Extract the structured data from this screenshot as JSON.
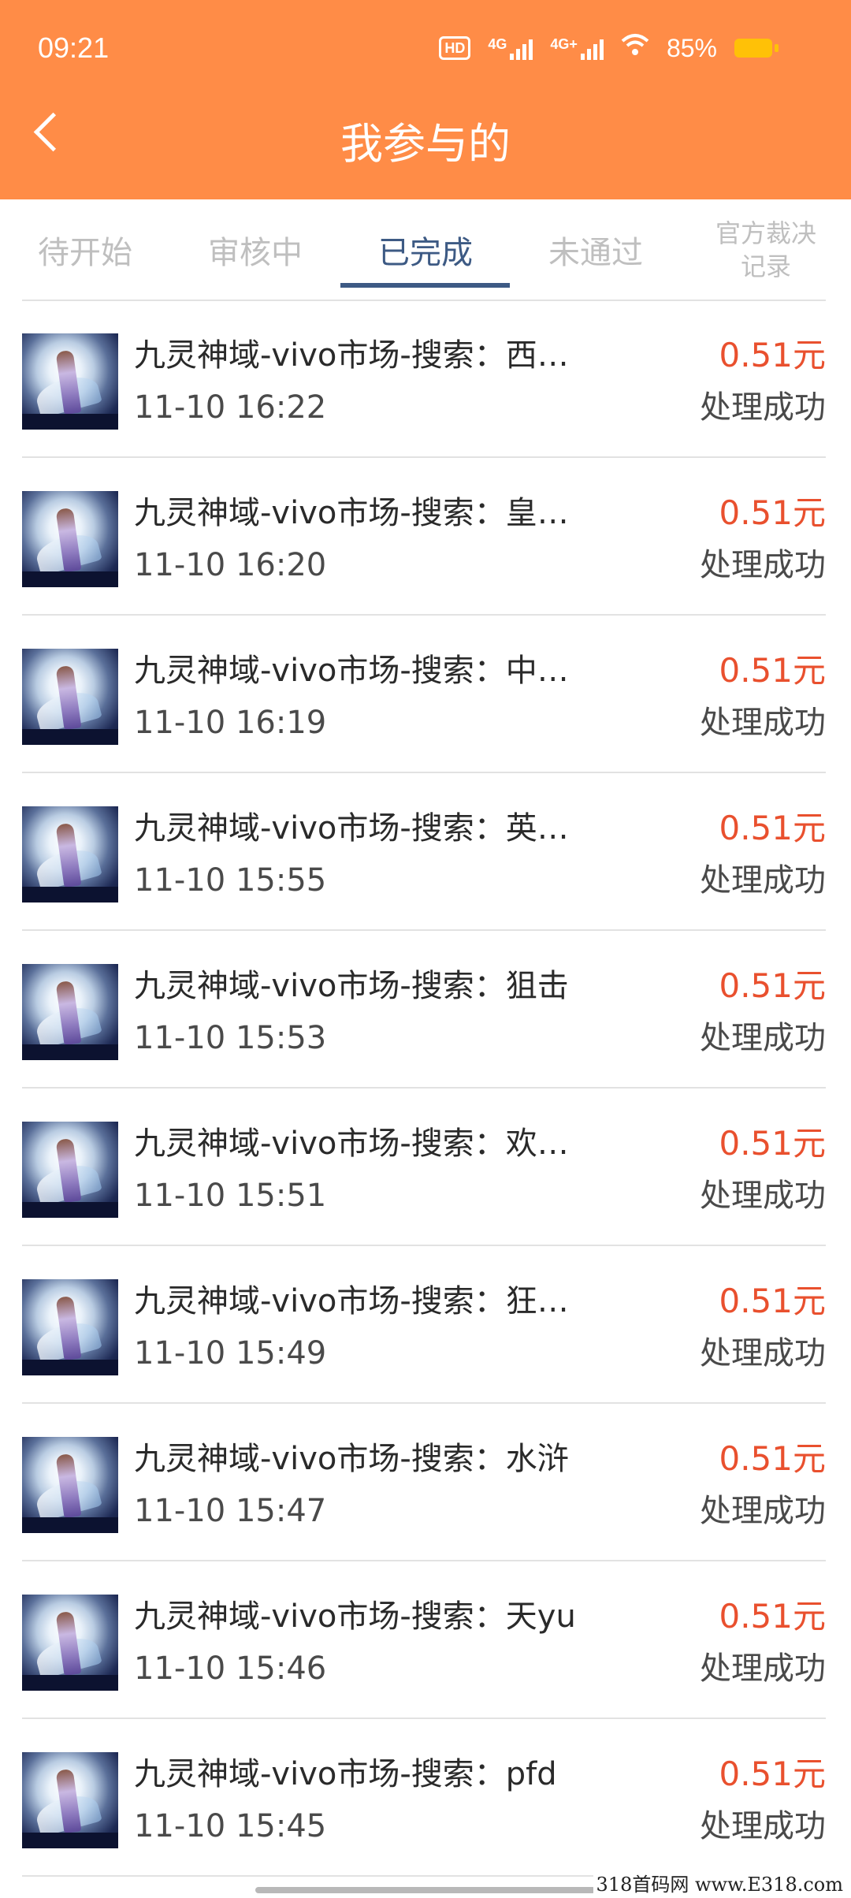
{
  "status_bar": {
    "time": "09:21",
    "hd_label": "HD",
    "net1": "4G",
    "net2": "4G+",
    "battery_percent": "85%"
  },
  "header": {
    "title": "我参与的"
  },
  "tabs": [
    {
      "label": "待开始",
      "active": false
    },
    {
      "label": "审核中",
      "active": false
    },
    {
      "label": "已完成",
      "active": true
    },
    {
      "label": "未通过",
      "active": false
    },
    {
      "label": "官方裁决记录",
      "line1": "官方裁决",
      "line2": "记录",
      "active": false
    }
  ],
  "items": [
    {
      "title": "九灵神域-vivo市场-搜索：西…",
      "time": "11-10 16:22",
      "amount": "0.51元",
      "status": "处理成功"
    },
    {
      "title": "九灵神域-vivo市场-搜索：皇…",
      "time": "11-10 16:20",
      "amount": "0.51元",
      "status": "处理成功"
    },
    {
      "title": "九灵神域-vivo市场-搜索：中…",
      "time": "11-10 16:19",
      "amount": "0.51元",
      "status": "处理成功"
    },
    {
      "title": "九灵神域-vivo市场-搜索：英…",
      "time": "11-10 15:55",
      "amount": "0.51元",
      "status": "处理成功"
    },
    {
      "title": "九灵神域-vivo市场-搜索：狙击",
      "time": "11-10 15:53",
      "amount": "0.51元",
      "status": "处理成功"
    },
    {
      "title": "九灵神域-vivo市场-搜索：欢…",
      "time": "11-10 15:51",
      "amount": "0.51元",
      "status": "处理成功"
    },
    {
      "title": "九灵神域-vivo市场-搜索：狂…",
      "time": "11-10 15:49",
      "amount": "0.51元",
      "status": "处理成功"
    },
    {
      "title": "九灵神域-vivo市场-搜索：水浒",
      "time": "11-10 15:47",
      "amount": "0.51元",
      "status": "处理成功"
    },
    {
      "title": "九灵神域-vivo市场-搜索：天yu",
      "time": "11-10 15:46",
      "amount": "0.51元",
      "status": "处理成功"
    },
    {
      "title": "九灵神域-vivo市场-搜索：pfd",
      "time": "11-10 15:45",
      "amount": "0.51元",
      "status": "处理成功"
    }
  ],
  "watermark": "318首码网 www.E318.com",
  "colors": {
    "header": "#FF8C47",
    "active_tab": "#3D5A84",
    "amount": "#E9502E"
  }
}
